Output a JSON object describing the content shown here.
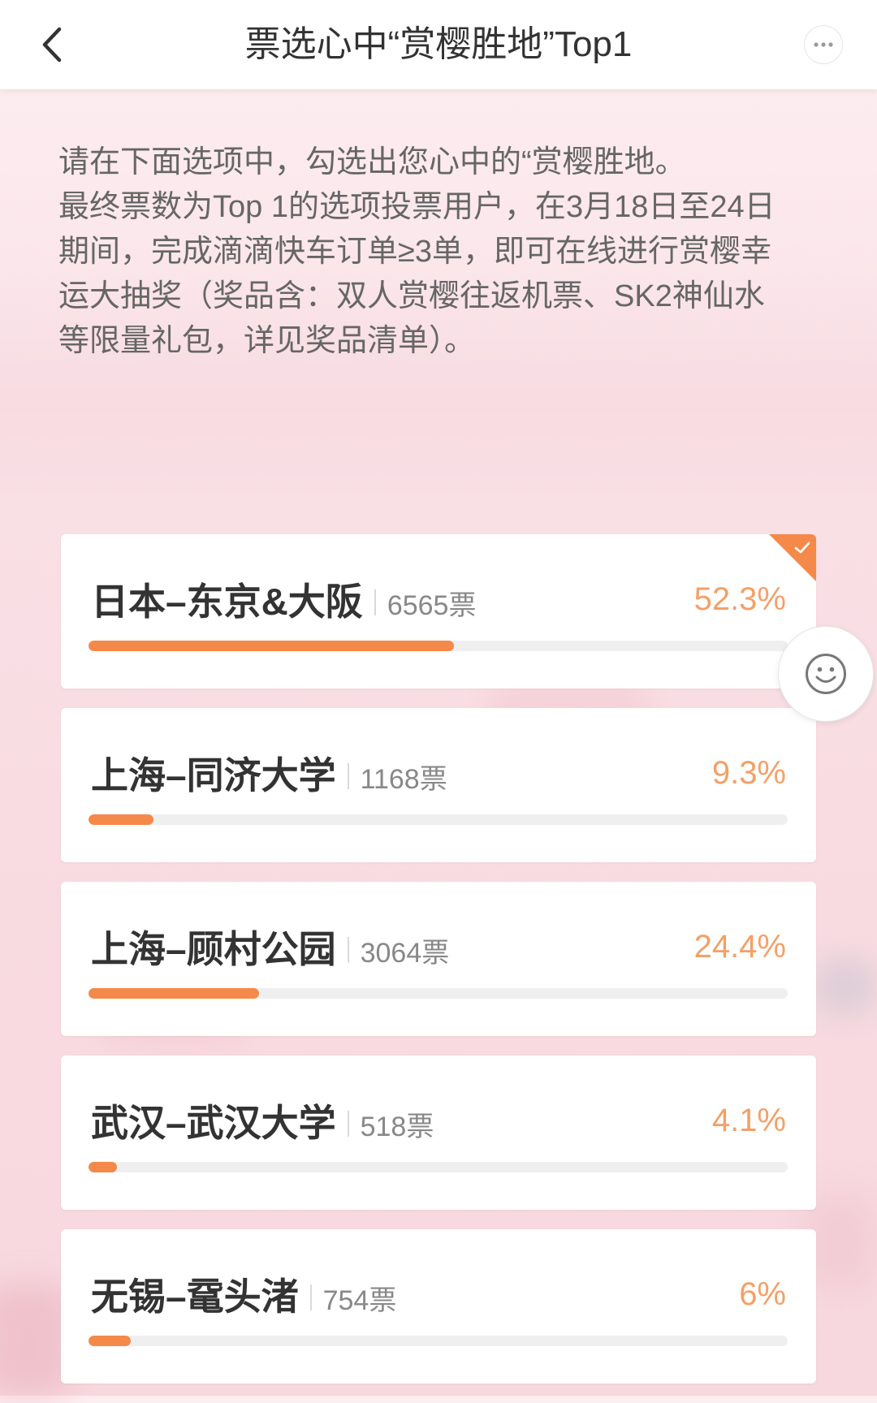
{
  "header": {
    "title": "票选心中“赏樱胜地”Top1",
    "back_icon": "chevron-left-icon",
    "more_icon": "more-dots-icon"
  },
  "intro": {
    "lines": [
      "请在下面选项中，勾选出您心中的“赏樱胜地。",
      "最终票数为Top 1的选项投票用户，在3月18日至24日",
      "期间，完成滴滴快车订单≥3单，即可在线进行赏樱幸",
      "运大抽奖（奖品含：双人赏樱往返机票、SK2神仙水",
      "等限量礼包，详见奖品清单）。"
    ]
  },
  "options": [
    {
      "name": "日本–东京&大阪",
      "votes": "6565票",
      "percent": "52.3%",
      "selected": true
    },
    {
      "name": "上海–同济大学",
      "votes": "1168票",
      "percent": "9.3%",
      "selected": false
    },
    {
      "name": "上海–顾村公园",
      "votes": "3064票",
      "percent": "24.4%",
      "selected": false
    },
    {
      "name": "武汉–武汉大学",
      "votes": "518票",
      "percent": "4.1%",
      "selected": false
    },
    {
      "name": "无锡–鼋头渚",
      "votes": "754票",
      "percent": "6%",
      "selected": false
    }
  ],
  "selected_icon": "checkmark-icon",
  "floating_button": {
    "icon": "smiley-icon"
  },
  "colors": {
    "accent": "#f5894a",
    "percent_text": "#f4a067",
    "title_text": "#333333",
    "body_text": "#666666",
    "muted_text": "#888888",
    "progress_track": "#efefef",
    "page_background": "#fbe6ea"
  }
}
